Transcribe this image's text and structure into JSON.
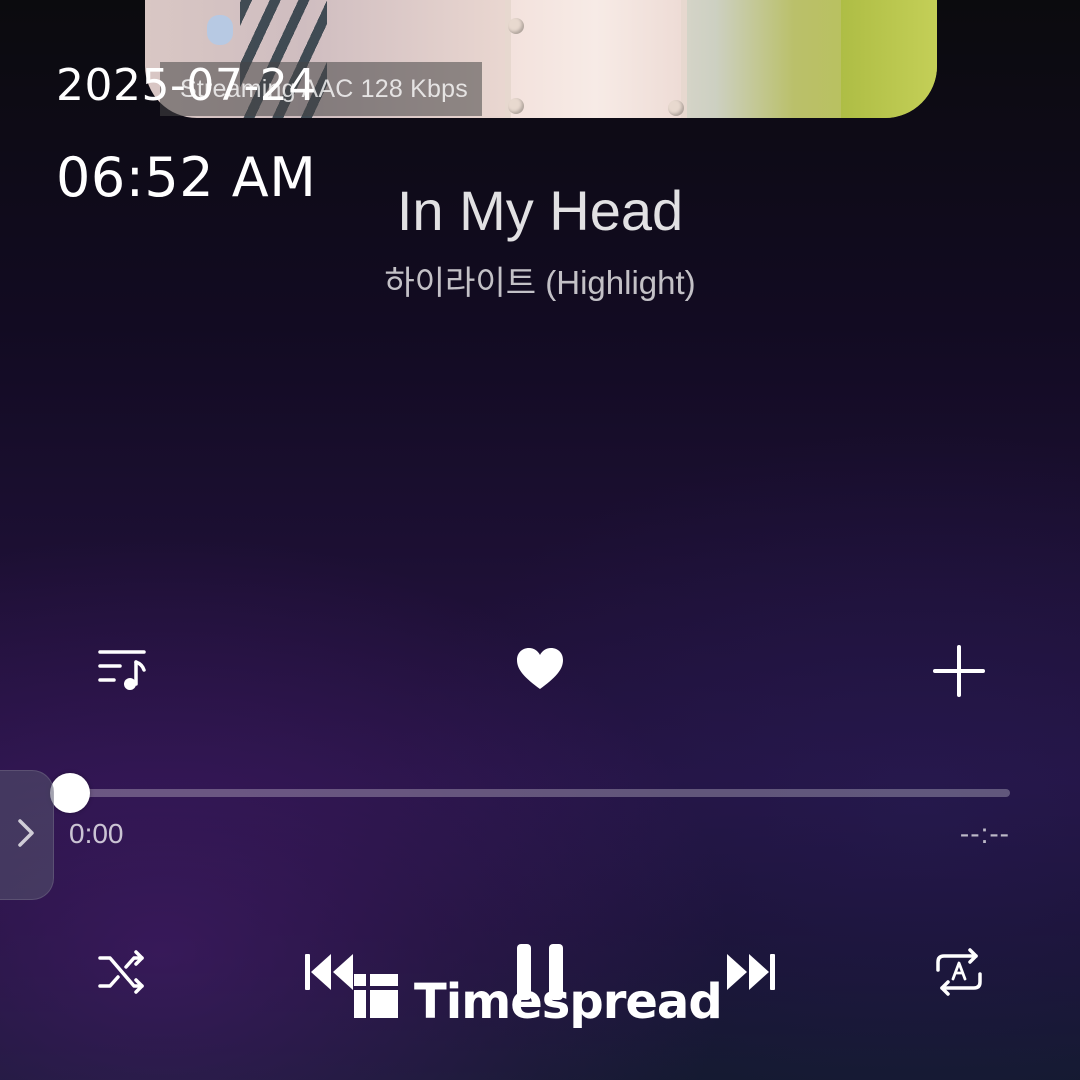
{
  "overlay": {
    "date": "2025-07-24",
    "time": "06:52 AM"
  },
  "stream_info": "Streaming AAC 128 Kbps",
  "track": {
    "title": "In My Head",
    "artist": "하이라이트 (Highlight)",
    "favorited": true
  },
  "playback": {
    "elapsed": "0:00",
    "remaining": "--:--",
    "progress_fraction": 0,
    "state": "playing"
  },
  "icons": {
    "queue": "playlist-icon",
    "favorite": "heart-icon",
    "add": "plus-icon",
    "shuffle": "shuffle-icon",
    "previous": "skip-previous-icon",
    "pause": "pause-icon",
    "next": "skip-next-icon",
    "repeat": "repeat-icon",
    "side_panel": "chevron-right-icon"
  },
  "watermark": {
    "text": "Timespread"
  }
}
